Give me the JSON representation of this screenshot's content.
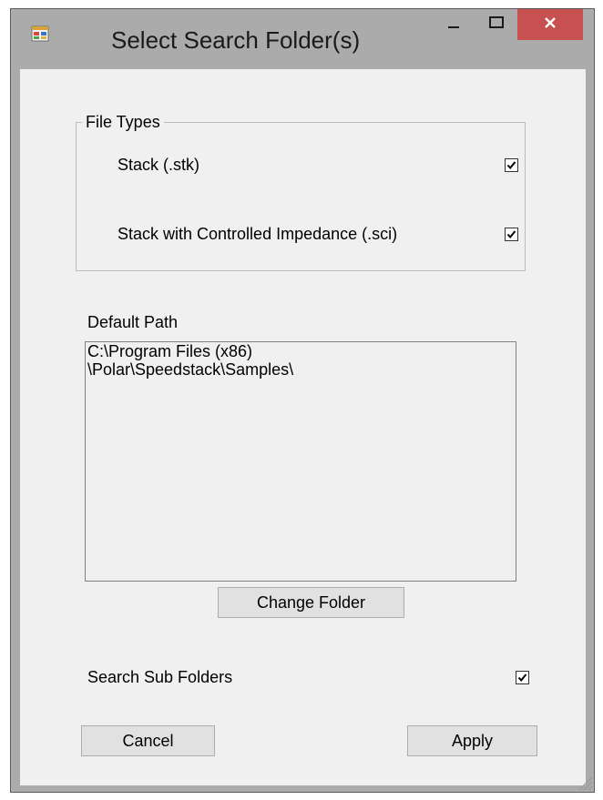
{
  "window": {
    "title": "Select Search Folder(s)",
    "controls": [
      "minimize-icon",
      "maximize-icon",
      "close-icon"
    ],
    "close_color": "#c75050"
  },
  "file_types": {
    "legend": "File Types",
    "items": [
      {
        "label": "Stack (.stk)",
        "checked": true
      },
      {
        "label": "Stack with Controlled Impedance (.sci)",
        "checked": true
      }
    ]
  },
  "default_path": {
    "label": "Default Path",
    "value": "C:\\Program Files (x86)\n\\Polar\\Speedstack\\Samples\\"
  },
  "change_folder_label": "Change Folder",
  "search_sub_folders": {
    "label": "Search Sub Folders",
    "checked": true
  },
  "buttons": {
    "cancel": "Cancel",
    "apply": "Apply"
  }
}
